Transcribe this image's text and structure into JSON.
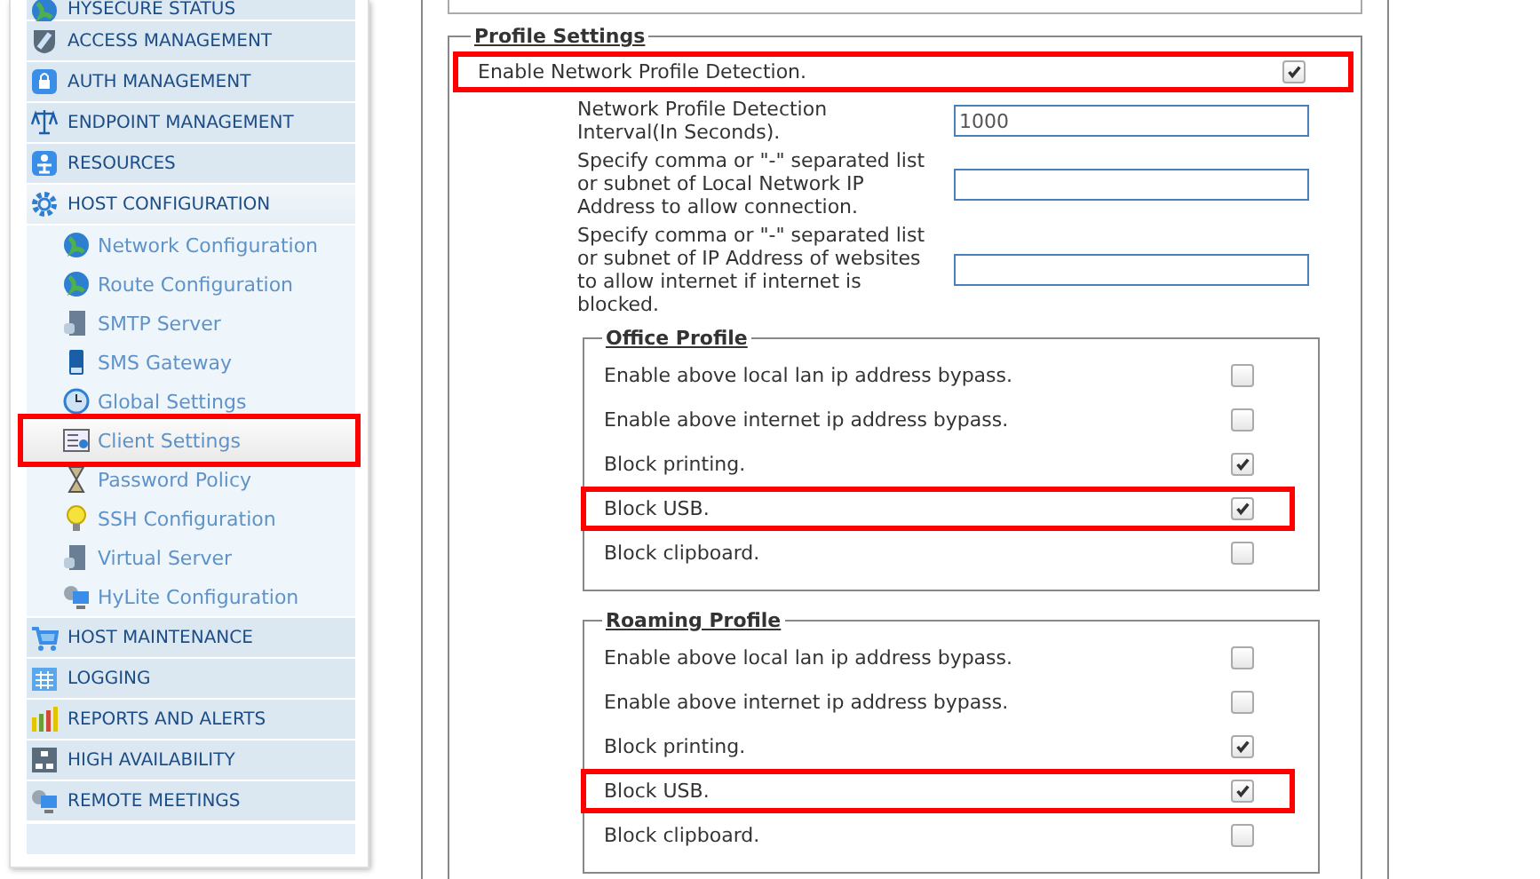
{
  "sidebar": {
    "items": [
      {
        "label": "HYSECURE STATUS",
        "expanded": false
      },
      {
        "label": "ACCESS MANAGEMENT",
        "expanded": false
      },
      {
        "label": "AUTH MANAGEMENT",
        "expanded": false
      },
      {
        "label": "ENDPOINT MANAGEMENT",
        "expanded": false
      },
      {
        "label": "RESOURCES",
        "expanded": false
      },
      {
        "label": "HOST CONFIGURATION",
        "expanded": true,
        "children": [
          {
            "label": "Network Configuration",
            "selected": false,
            "highlighted": false
          },
          {
            "label": "Route Configuration",
            "selected": false,
            "highlighted": false
          },
          {
            "label": "SMTP Server",
            "selected": false,
            "highlighted": false
          },
          {
            "label": "SMS Gateway",
            "selected": false,
            "highlighted": false
          },
          {
            "label": "Global Settings",
            "selected": false,
            "highlighted": false
          },
          {
            "label": "Client Settings",
            "selected": true,
            "highlighted": true
          },
          {
            "label": "Password Policy",
            "selected": false,
            "highlighted": false
          },
          {
            "label": "SSH Configuration",
            "selected": false,
            "highlighted": false
          },
          {
            "label": "Virtual Server",
            "selected": false,
            "highlighted": false
          },
          {
            "label": "HyLite Configuration",
            "selected": false,
            "highlighted": false
          }
        ]
      },
      {
        "label": "HOST MAINTENANCE",
        "expanded": false
      },
      {
        "label": "LOGGING",
        "expanded": false
      },
      {
        "label": "REPORTS AND ALERTS",
        "expanded": false
      },
      {
        "label": "HIGH AVAILABILITY",
        "expanded": false
      },
      {
        "label": "REMOTE MEETINGS",
        "expanded": false
      }
    ]
  },
  "profile_settings": {
    "title": "Profile Settings",
    "enable_detection": {
      "label": "Enable Network Profile Detection.",
      "checked": true,
      "highlighted": true
    },
    "fields": [
      {
        "label": "Network Profile Detection Interval(In Seconds).",
        "value": "1000"
      },
      {
        "label": "Specify comma or \"-\" separated list or subnet of Local Network IP Address to allow connection."
      },
      {
        "label": "Specify comma or \"-\" separated list or subnet of IP Address of websites to allow internet if internet is blocked."
      }
    ],
    "profiles": [
      {
        "title": "Office Profile",
        "options": [
          {
            "label": "Enable above local lan ip address bypass.",
            "checked": false,
            "highlighted": false
          },
          {
            "label": "Enable above internet ip address bypass.",
            "checked": false,
            "highlighted": false
          },
          {
            "label": "Block printing.",
            "checked": true,
            "highlighted": false
          },
          {
            "label": "Block USB.",
            "checked": true,
            "highlighted": true
          },
          {
            "label": "Block clipboard.",
            "checked": false,
            "highlighted": false
          }
        ]
      },
      {
        "title": "Roaming Profile",
        "options": [
          {
            "label": "Enable above local lan ip address bypass.",
            "checked": false,
            "highlighted": false
          },
          {
            "label": "Enable above internet ip address bypass.",
            "checked": false,
            "highlighted": false
          },
          {
            "label": "Block printing.",
            "checked": true,
            "highlighted": false
          },
          {
            "label": "Block USB.",
            "checked": true,
            "highlighted": true
          },
          {
            "label": "Block clipboard.",
            "checked": false,
            "highlighted": false
          }
        ]
      }
    ]
  }
}
